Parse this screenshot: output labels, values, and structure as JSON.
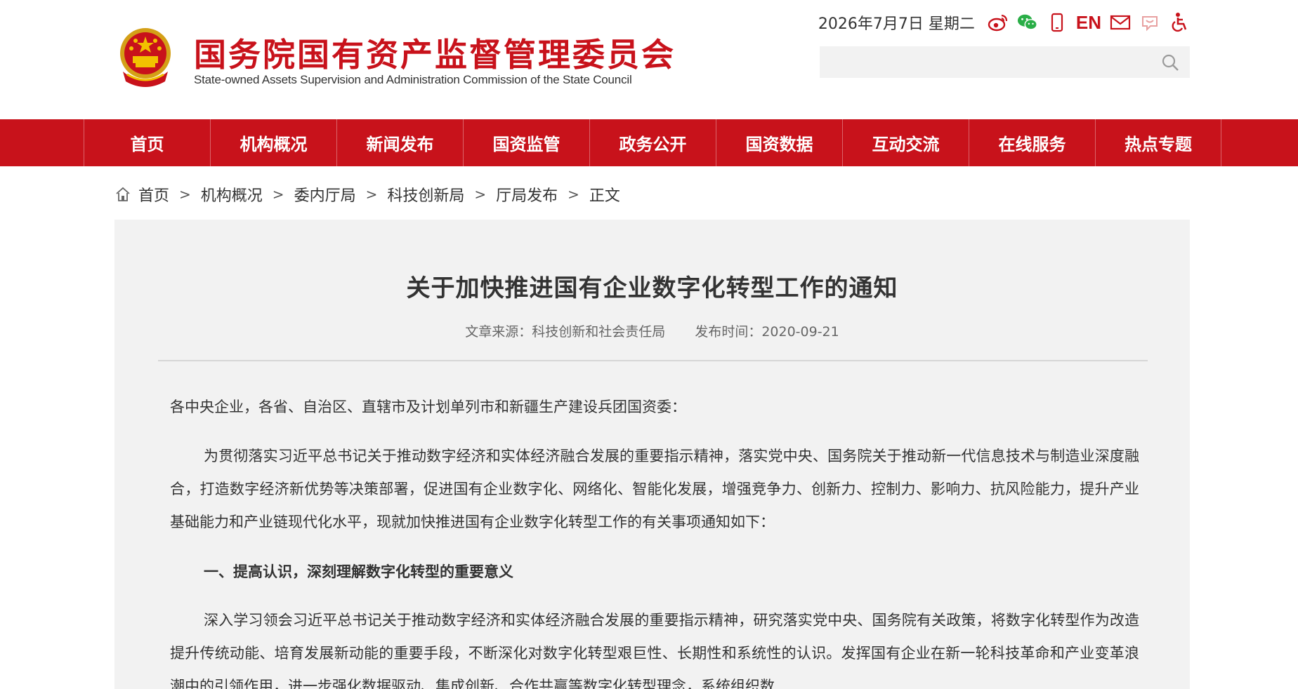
{
  "header": {
    "site_name": "国务院国有资产监督管理委员会",
    "site_name_en": "State-owned Assets Supervision and Administration Commission of the State Council",
    "date": "2026年7月7日 星期二",
    "lang_en": "EN",
    "search": {
      "value": "",
      "placeholder": ""
    },
    "icons": [
      "weibo-icon",
      "wechat-icon",
      "mobile-icon",
      "en-link",
      "mail-icon",
      "message-icon",
      "accessibility-icon"
    ],
    "brand_color": "#c8121b"
  },
  "nav": {
    "items": [
      {
        "label": "首页"
      },
      {
        "label": "机构概况"
      },
      {
        "label": "新闻发布"
      },
      {
        "label": "国资监管"
      },
      {
        "label": "政务公开"
      },
      {
        "label": "国资数据"
      },
      {
        "label": "互动交流"
      },
      {
        "label": "在线服务"
      },
      {
        "label": "热点专题"
      }
    ]
  },
  "breadcrumb": {
    "items": [
      "首页",
      "机构概况",
      "委内厅局",
      "科技创新局",
      "厅局发布",
      "正文"
    ],
    "separator": ">"
  },
  "article": {
    "title": "关于加快推进国有企业数字化转型工作的通知",
    "source": "文章来源：科技创新和社会责任局",
    "published": "发布时间：2020-09-21",
    "salutation": "各中央企业，各省、自治区、直辖市及计划单列市和新疆生产建设兵团国资委：",
    "paragraph1": "为贯彻落实习近平总书记关于推动数字经济和实体经济融合发展的重要指示精神，落实党中央、国务院关于推动新一代信息技术与制造业深度融合，打造数字经济新优势等决策部署，促进国有企业数字化、网络化、智能化发展，增强竞争力、创新力、控制力、影响力、抗风险能力，提升产业基础能力和产业链现代化水平，现就加快推进国有企业数字化转型工作的有关事项通知如下：",
    "heading1": "一、提高认识，深刻理解数字化转型的重要意义",
    "paragraph2": "深入学习领会习近平总书记关于推动数字经济和实体经济融合发展的重要指示精神，研究落实党中央、国务院有关政策，将数字化转型作为改造提升传统动能、培育发展新动能的重要手段，不断深化对数字化转型艰巨性、长期性和系统性的认识。发挥国有企业在新一轮科技革命和产业变革浪潮中的引领作用，进一步强化数据驱动、集成创新、合作共赢等数字化转型理念，系统组织数"
  }
}
